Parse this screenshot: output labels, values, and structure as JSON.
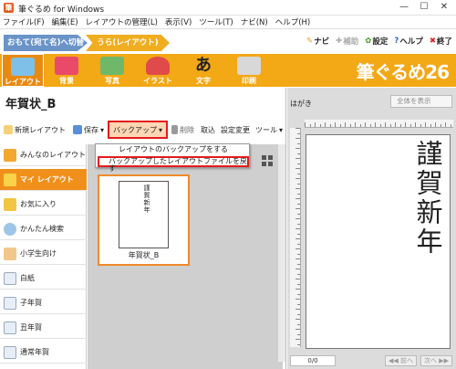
{
  "window": {
    "title": "筆ぐるめ for Windows",
    "app_icon": "筆",
    "min": "—",
    "max": "☐",
    "close": "✕"
  },
  "menu": [
    "ファイル(F)",
    "編集(E)",
    "レイアウトの管理(L)",
    "表示(V)",
    "ツール(T)",
    "ナビ(N)",
    "ヘルプ(H)"
  ],
  "tabs": {
    "omote": "おもて(宛て名)へ切替",
    "ura": "うら(レイアウト)"
  },
  "toplinks": {
    "navi": "ナビ",
    "hojo": "補助",
    "settei": "設定",
    "help": "ヘルプ",
    "end": "終了"
  },
  "ribbon": [
    "レイアウト",
    "背景",
    "写真",
    "イラスト",
    "文字",
    "印刷"
  ],
  "brand": "筆ぐるめ26",
  "doc_title": "年賀状_B",
  "toolbar": {
    "new": "新規レイアウト",
    "save": "保存",
    "backup": "バックアップ",
    "delete": "削除",
    "import": "取込",
    "settings": "設定変更",
    "tools": "ツール"
  },
  "dropdown": {
    "item1": "レイアウトのバックアップをする",
    "item2": "バックアップしたレイアウトファイルを戻す"
  },
  "sidebar": [
    {
      "label": "みんなのレイアウト",
      "icon": "people-icon",
      "color": "#f2a72e"
    },
    {
      "label": "マイ レイアウト",
      "icon": "person-icon",
      "color": "#f8d34a"
    },
    {
      "label": "お気に入り",
      "icon": "star-icon",
      "color": "#f4c542"
    },
    {
      "label": "かんたん検索",
      "icon": "magnifier-icon",
      "color": "#9ec6e8"
    },
    {
      "label": "小学生向け",
      "icon": "child-icon",
      "color": "#f2c88a"
    },
    {
      "label": "白紙",
      "icon": "blank-page-icon",
      "color": "#e8eef8"
    },
    {
      "label": "子年賀",
      "icon": "card-icon",
      "color": "#e8eef8"
    },
    {
      "label": "丑年賀",
      "icon": "card-icon",
      "color": "#e8eef8"
    },
    {
      "label": "通常年賀",
      "icon": "card-icon",
      "color": "#e8eef8"
    }
  ],
  "thumbnail": {
    "text": "謹賀新年",
    "label": "年賀状_B"
  },
  "preview": {
    "label": "はがき",
    "zoom": "全体を表示",
    "text": "謹賀新年"
  },
  "pager": {
    "count": "0/0",
    "prev": "◀◀ 前へ",
    "next": "次へ ▶▶"
  },
  "colors": {
    "accent": "#f3a816",
    "highlight": "#e41b1b"
  }
}
